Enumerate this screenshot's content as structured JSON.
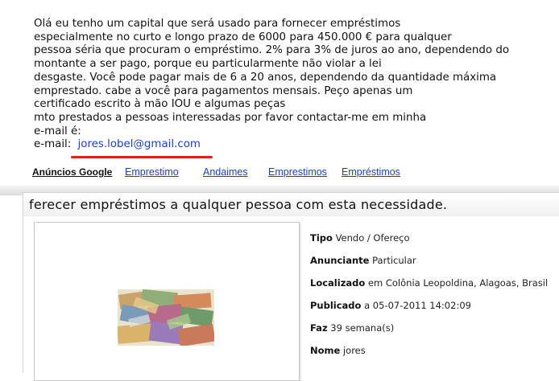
{
  "description": {
    "lines": [
      "Olá eu tenho um capital que será usado para fornecer empréstimos",
      "especialmente no curto e longo prazo de 6000 para 450.000 € para qualquer",
      "pessoa séria que procuram o empréstimo. 2% para 3% de juros ao ano, dependendo do",
      "montante a ser pago, porque eu particularmente não violar a lei",
      "desgaste. Você pode pagar mais de 6 a 20 anos, dependendo da quantidade máxima",
      "emprestado. cabe a você para pagamentos mensais. Peço apenas um",
      "certificado escrito à mão IOU e algumas peças",
      "mto prestados a pessoas interessadas por favor contactar-me em minha",
      "e-mail é:"
    ],
    "email_prefix": "e-mail:",
    "email": "jores.lobel@gmail.com"
  },
  "ads": {
    "title": "Anúncios Google",
    "links": [
      "Emprestimo",
      "Andaimes",
      "Emprestimos",
      "Empréstimos"
    ]
  },
  "listing": {
    "title": "ferecer empréstimos a qualquer pessoa com esta necessidade.",
    "info": [
      {
        "key": "Tipo",
        "value": "Vendo / Ofereço"
      },
      {
        "key": "Anunciante",
        "value": "Particular"
      },
      {
        "key": "Localizado",
        "value": "em Colônia Leopoldina, Alagoas, Brasil"
      },
      {
        "key": "Publicado",
        "value": "a 05-07-2011 14:02:09"
      },
      {
        "key": "Faz",
        "value": "39 semana(s)"
      },
      {
        "key": "Nome",
        "value": "jores"
      }
    ]
  }
}
